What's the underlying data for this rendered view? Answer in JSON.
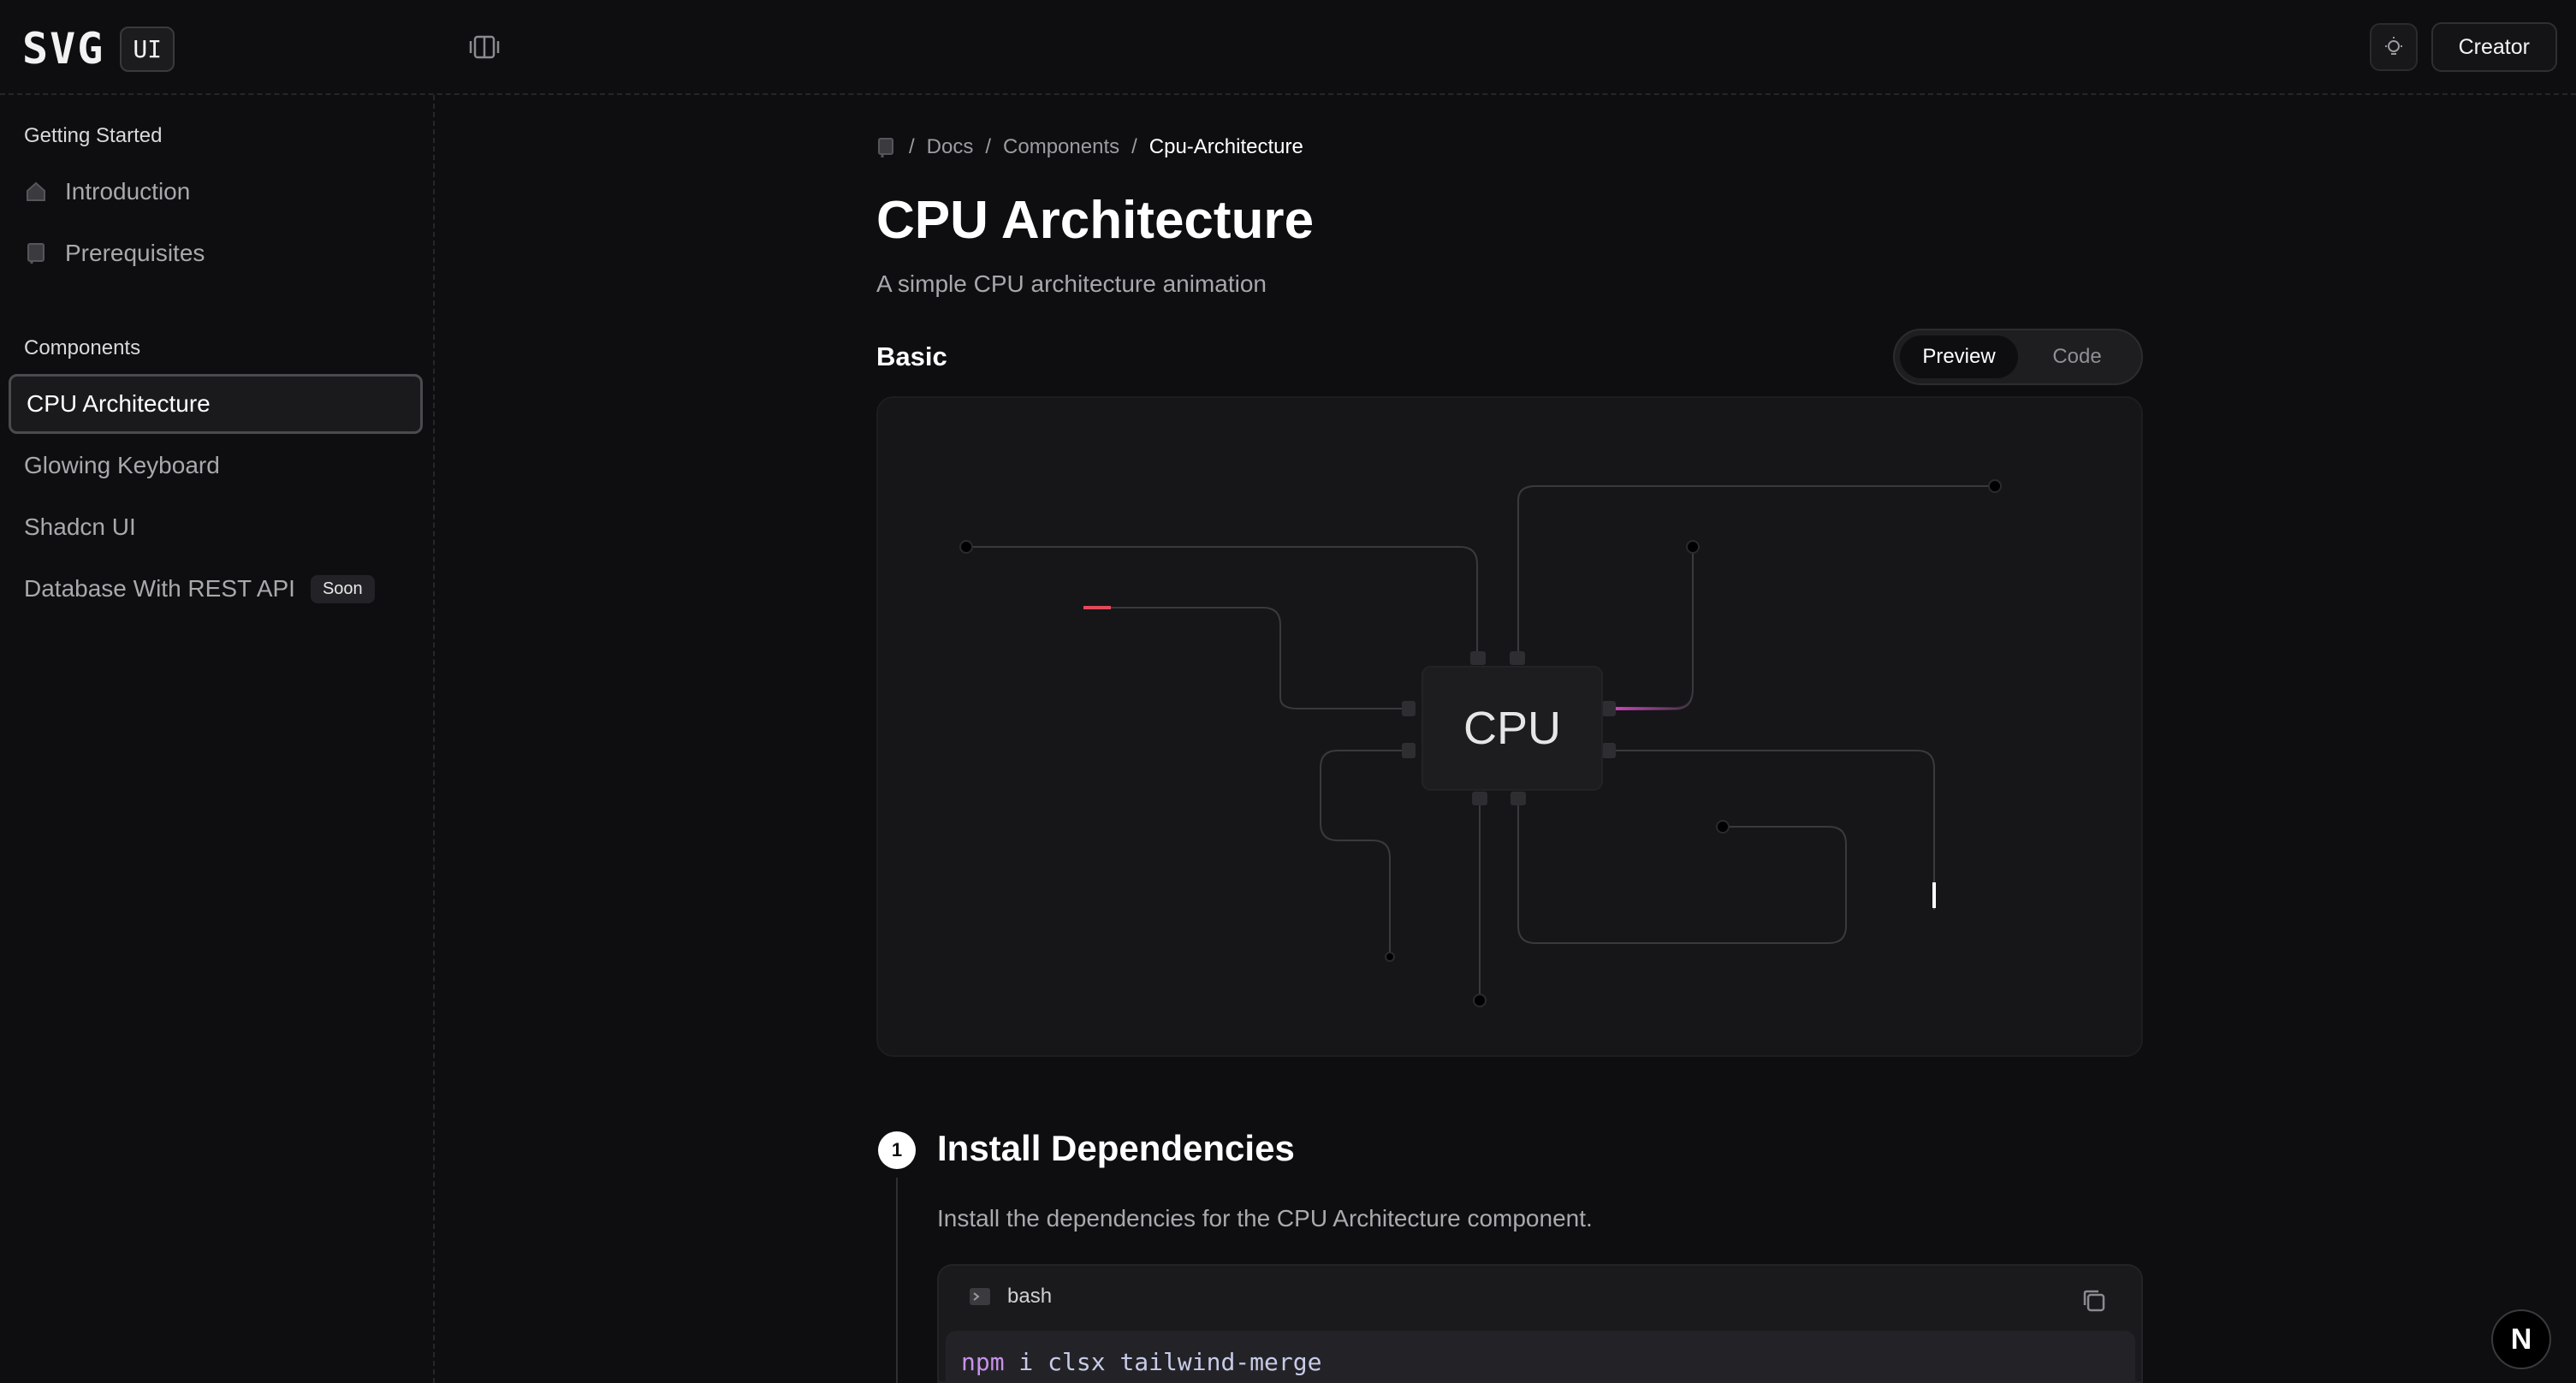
{
  "logo": {
    "text": "SVG",
    "badge": "UI"
  },
  "header": {
    "creator_label": "Creator"
  },
  "sidebar": {
    "sections": [
      {
        "title": "Getting Started"
      },
      {
        "title": "Components"
      }
    ],
    "items": [
      {
        "label": "Introduction",
        "icon": "home-icon"
      },
      {
        "label": "Prerequisites",
        "icon": "book-icon"
      },
      {
        "label": "CPU Architecture"
      },
      {
        "label": "Glowing Keyboard"
      },
      {
        "label": "Shadcn UI"
      },
      {
        "label": "Database With REST API",
        "badge": "Soon"
      }
    ]
  },
  "breadcrumb": {
    "items": [
      "Docs",
      "Components",
      "Cpu-Architecture"
    ]
  },
  "page": {
    "title": "CPU Architecture",
    "subtitle": "A simple CPU architecture animation",
    "section": "Basic",
    "tabs": [
      "Preview",
      "Code"
    ],
    "active_tab": "Preview"
  },
  "preview": {
    "chip_label": "CPU"
  },
  "step": {
    "number": "1",
    "title": "Install Dependencies",
    "description": "Install the dependencies for the CPU Architecture component.",
    "code_lang": "bash",
    "code_cmd": "npm",
    "code_args": " i clsx tailwind-merge"
  },
  "colors": {
    "background": "#0e0e10",
    "accent_blue": "#3b9cf0",
    "accent_yellow": "#f2d23a",
    "accent_pink": "#d946c8",
    "accent_red": "#e24a5a",
    "accent_orange": "#f08a2a"
  }
}
